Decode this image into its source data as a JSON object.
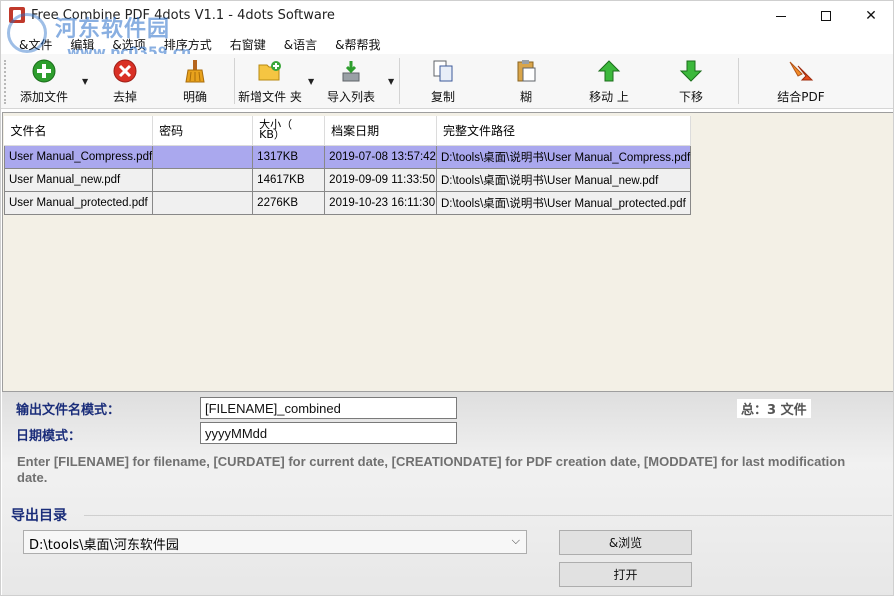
{
  "window": {
    "title": "Free Combine PDF 4dots V1.1 - 4dots Software"
  },
  "watermark": {
    "line1": "河东软件园",
    "line2": "www.pc0359.cn"
  },
  "menu": [
    "&文件",
    "编辑",
    "&选项",
    "排序方式",
    "右窗键",
    "&语言",
    "&帮帮我"
  ],
  "toolbar": {
    "add_file": "添加文件",
    "remove": "去掉",
    "clear": "明确",
    "add_folder": "新增文件 夹",
    "import_list": "导入列表",
    "copy": "复制",
    "paste": "糊",
    "move_up": "移动 上",
    "move_down": "下移",
    "combine": "结合PDF"
  },
  "grid": {
    "columns": {
      "filename": "文件名",
      "password": "密码",
      "size_line1": "大小（",
      "size_line2": "KB）",
      "date": "档案日期",
      "path": "完整文件路径"
    },
    "rows": [
      {
        "filename": "User Manual_Compress.pdf",
        "password": "",
        "size": "1317KB",
        "date": "2019-07-08 13:57:42",
        "path": "D:\\tools\\桌面\\说明书\\User Manual_Compress.pdf",
        "selected": true
      },
      {
        "filename": "User Manual_new.pdf",
        "password": "",
        "size": "14617KB",
        "date": "2019-09-09 11:33:50",
        "path": "D:\\tools\\桌面\\说明书\\User Manual_new.pdf",
        "selected": false
      },
      {
        "filename": "User Manual_protected.pdf",
        "password": "",
        "size": "2276KB",
        "date": "2019-10-23 16:11:30",
        "path": "D:\\tools\\桌面\\说明书\\User Manual_protected.pdf",
        "selected": false
      }
    ]
  },
  "output": {
    "filename_pattern_label": "输出文件名模式：",
    "filename_pattern_value": "[FILENAME]_combined",
    "date_pattern_label": "日期模式：",
    "date_pattern_value": "yyyyMMdd",
    "total": "总：3 文件",
    "hint": "Enter [FILENAME] for filename, [CURDATE] for current date, [CREATIONDATE] for PDF creation date, [MODDATE] for last modification date.",
    "folder_label": "导出目录",
    "folder_value": "D:\\tools\\桌面\\河东软件园",
    "browse_button": "&浏览",
    "open_button": "打开"
  },
  "colors": {
    "selected_row": "#aaa8ee",
    "label_blue": "#1a2d7a",
    "grid_bg": "#f3f0e6"
  }
}
